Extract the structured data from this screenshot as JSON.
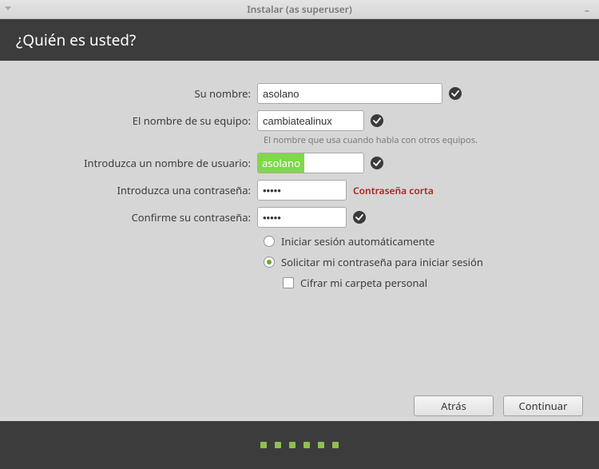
{
  "window": {
    "title": "Instalar (as superuser)"
  },
  "header": {
    "title": "¿Quién es usted?"
  },
  "form": {
    "name_label": "Su nombre:",
    "name_value": "asolano",
    "host_label": "El nombre de su equipo:",
    "host_value": "cambiatealinux",
    "host_hint": "El nombre que usa cuando habla con otros equipos.",
    "user_label": "Introduzca un nombre de usuario:",
    "user_value": "asolano",
    "pass_label": "Introduzca una contraseña:",
    "pass_value": "•••••",
    "pass_warn": "Contraseña corta",
    "confirm_label": "Confirme su contraseña:",
    "confirm_value": "•••••"
  },
  "options": {
    "auto_login": "Iniciar sesión automáticamente",
    "require_password": "Solicitar mi contraseña para iniciar sesión",
    "encrypt_home": "Cifrar mi carpeta personal"
  },
  "buttons": {
    "back": "Atrás",
    "continue": "Continuar"
  }
}
